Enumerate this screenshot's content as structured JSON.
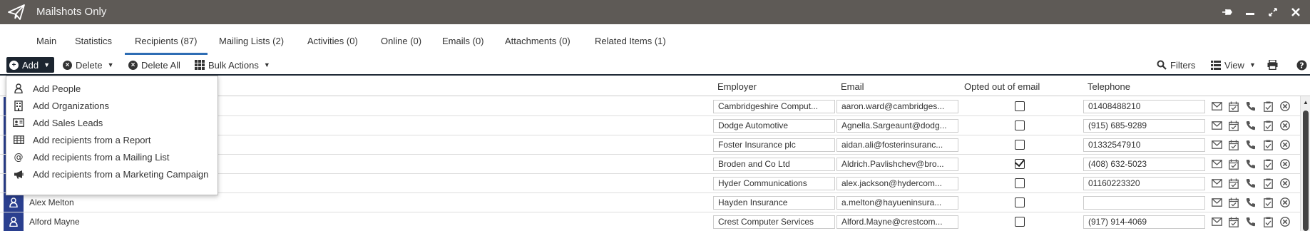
{
  "window": {
    "title": "Mailshots Only"
  },
  "tabs": [
    {
      "label": "Main"
    },
    {
      "label": "Statistics"
    },
    {
      "label": "Recipients (87)"
    },
    {
      "label": "Mailing Lists (2)"
    },
    {
      "label": "Activities (0)"
    },
    {
      "label": "Online (0)"
    },
    {
      "label": "Emails (0)"
    },
    {
      "label": "Attachments (0)"
    },
    {
      "label": "Related Items (1)"
    }
  ],
  "toolbar": {
    "add_label": "Add",
    "delete_label": "Delete",
    "delete_all_label": "Delete All",
    "bulk_actions_label": "Bulk Actions",
    "filters_label": "Filters",
    "view_label": "View"
  },
  "add_menu": [
    {
      "label": "Add People",
      "icon": "person-icon"
    },
    {
      "label": "Add Organizations",
      "icon": "building-icon"
    },
    {
      "label": "Add Sales Leads",
      "icon": "id-card-icon"
    },
    {
      "label": "Add recipients from a Report",
      "icon": "table-icon"
    },
    {
      "label": "Add recipients from a Mailing List",
      "icon": "at-icon"
    },
    {
      "label": "Add recipients from a Marketing Campaign",
      "icon": "megaphone-icon"
    }
  ],
  "columns": {
    "employer": "Employer",
    "email": "Email",
    "opted_out": "Opted out of email",
    "telephone": "Telephone"
  },
  "rows": [
    {
      "name": "",
      "employer": "Cambridgeshire Comput...",
      "email": "aaron.ward@cambridges...",
      "opted_out": false,
      "telephone": "01408488210"
    },
    {
      "name": "",
      "employer": "Dodge Automotive",
      "email": "Agnella.Sargeaunt@dodg...",
      "opted_out": false,
      "telephone": "(915) 685-9289"
    },
    {
      "name": "",
      "employer": "Foster Insurance plc",
      "email": "aidan.ali@fosterinsuranc...",
      "opted_out": false,
      "telephone": "01332547910"
    },
    {
      "name": "",
      "employer": "Broden and Co Ltd",
      "email": "Aldrich.Pavlishchev@bro...",
      "opted_out": true,
      "telephone": "(408) 632-5023"
    },
    {
      "name": "",
      "employer": "Hyder Communications",
      "email": "alex.jackson@hydercom...",
      "opted_out": false,
      "telephone": "01160223320"
    },
    {
      "name": "Alex Melton",
      "employer": "Hayden Insurance",
      "email": "a.melton@hayueninsura...",
      "opted_out": false,
      "telephone": ""
    },
    {
      "name": "Alford Mayne",
      "employer": "Crest Computer Services",
      "email": "Alford.Mayne@crestcom...",
      "opted_out": false,
      "telephone": "(917) 914-4069"
    }
  ],
  "colors": {
    "titlebar": "#5e5a56",
    "accent": "#2e6db4",
    "avatar": "#2a3f8f",
    "toolbar_dark": "#1c2530"
  }
}
